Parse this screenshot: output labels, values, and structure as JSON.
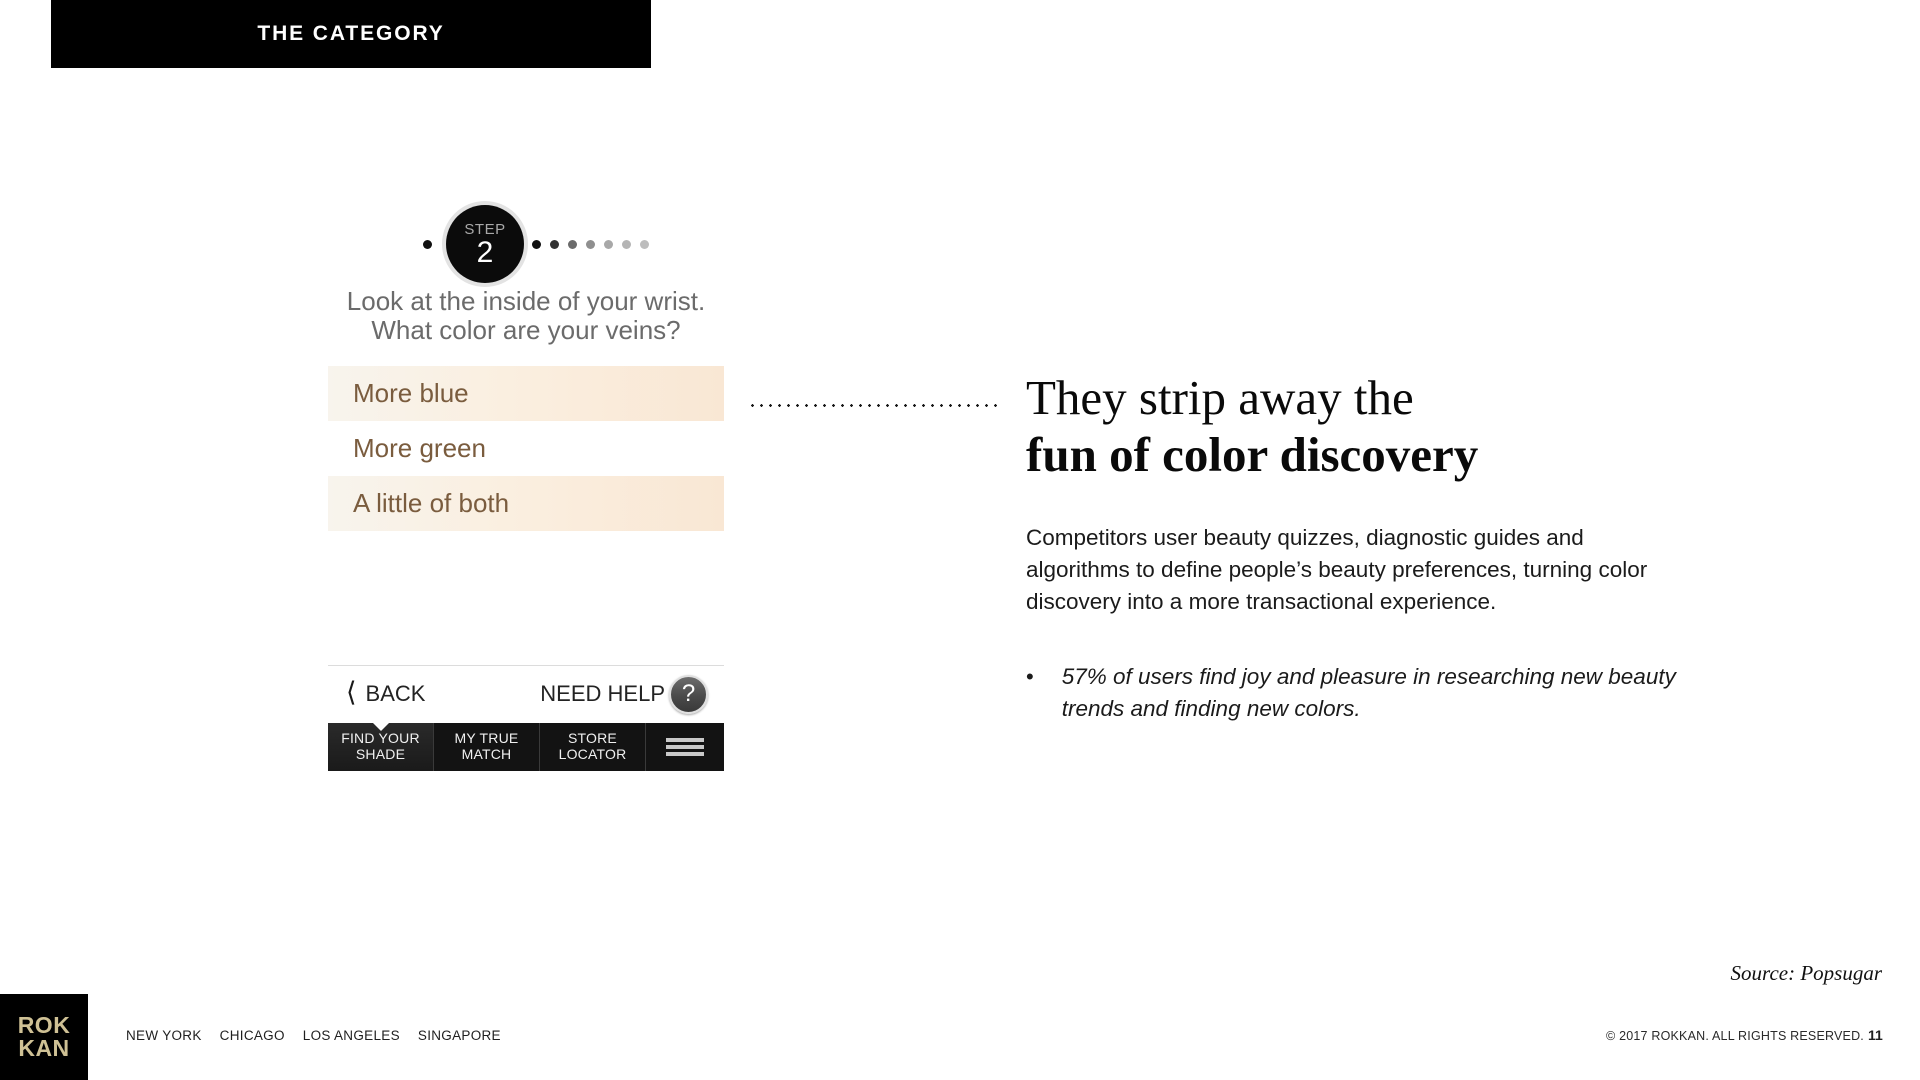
{
  "header": {
    "category_label": "THE CATEGORY"
  },
  "phone": {
    "step": {
      "word": "STEP",
      "number": "2",
      "dots_left": [
        "#111111"
      ],
      "dots_right": [
        "#111111",
        "#333333",
        "#6b6b6b",
        "#8f8f8f",
        "#a8a8a8",
        "#b5b5b5",
        "#bdbdbd"
      ]
    },
    "question_line1": "Look at the inside of your wrist.",
    "question_line2": "What color are your veins?",
    "options": [
      {
        "label": "More blue",
        "shaded": true
      },
      {
        "label": "More green",
        "shaded": false
      },
      {
        "label": "A little of both",
        "shaded": true
      }
    ],
    "helpbar": {
      "back_label": "BACK",
      "back_icon": "chevron-left-icon",
      "need_help_label": "NEED HELP",
      "help_icon_glyph": "?"
    },
    "tabbar": {
      "items": [
        {
          "line1": "FIND YOUR",
          "line2": "SHADE",
          "active": true
        },
        {
          "line1": "MY TRUE",
          "line2": "MATCH",
          "active": false
        },
        {
          "line1": "STORE",
          "line2": "LOCATOR",
          "active": false
        }
      ],
      "menu_icon": "hamburger-menu-icon"
    }
  },
  "content": {
    "headline_line1": "They strip away the",
    "headline_line2": "fun of color discovery",
    "paragraph": "Competitors user beauty quizzes, diagnostic guides and algorithms to define people’s beauty preferences, turning color discovery into a more transactional experience.",
    "bullets": [
      "57% of users find joy and pleasure in researching new beauty trends and finding new colors."
    ],
    "bullet_glyph": "•"
  },
  "source": "Source: Popsugar",
  "footer": {
    "logo_line1": "ROK",
    "logo_line2": "KAN",
    "cities": [
      "NEW YORK",
      "CHICAGO",
      "LOS ANGELES",
      "SINGAPORE"
    ],
    "copyright": "© 2017 ROKKAN. ALL RIGHTS RESERVED.",
    "page_number": "11"
  },
  "colors": {
    "brand_black": "#000000",
    "logo_tan": "#cfc195",
    "option_text_brown": "#7a5c3e",
    "option_shade_left": "#f8f4ed",
    "option_shade_right": "#f9e7d4",
    "question_gray": "#6b6b6b"
  }
}
